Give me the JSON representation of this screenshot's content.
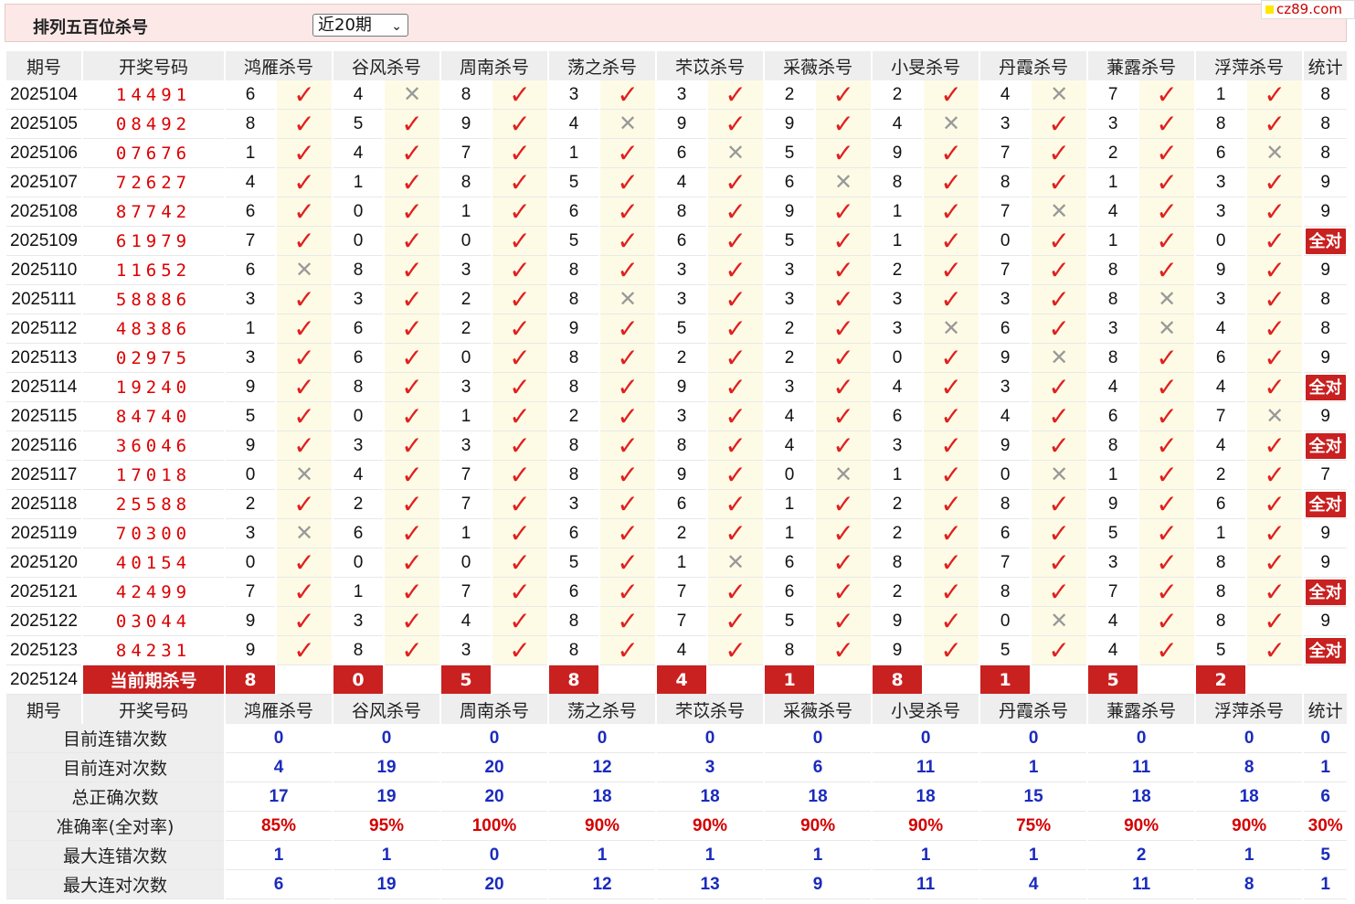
{
  "header": {
    "title": "排列五百位杀号",
    "select_value": "近20期",
    "logo": "cz89.com"
  },
  "columns": {
    "issue": "期号",
    "draw": "开奖号码",
    "experts": [
      "鸿雁杀号",
      "谷风杀号",
      "周南杀号",
      "荡之杀号",
      "芣苡杀号",
      "采薇杀号",
      "小旻杀号",
      "丹霞杀号",
      "蒹露杀号",
      "浮萍杀号"
    ],
    "stat": "统计"
  },
  "rows": [
    {
      "issue": "2025104",
      "draw": "14491",
      "kills": [
        6,
        4,
        8,
        3,
        3,
        2,
        2,
        4,
        7,
        1
      ],
      "hits": [
        1,
        0,
        1,
        1,
        1,
        1,
        1,
        0,
        1,
        1
      ],
      "stat": "8"
    },
    {
      "issue": "2025105",
      "draw": "08492",
      "kills": [
        8,
        5,
        9,
        4,
        9,
        9,
        4,
        3,
        3,
        8
      ],
      "hits": [
        1,
        1,
        1,
        0,
        1,
        1,
        0,
        1,
        1,
        1
      ],
      "stat": "8"
    },
    {
      "issue": "2025106",
      "draw": "07676",
      "kills": [
        1,
        4,
        7,
        1,
        6,
        5,
        9,
        7,
        2,
        6
      ],
      "hits": [
        1,
        1,
        1,
        1,
        0,
        1,
        1,
        1,
        1,
        0
      ],
      "stat": "8"
    },
    {
      "issue": "2025107",
      "draw": "72627",
      "kills": [
        4,
        1,
        8,
        5,
        4,
        6,
        8,
        8,
        1,
        3
      ],
      "hits": [
        1,
        1,
        1,
        1,
        1,
        0,
        1,
        1,
        1,
        1
      ],
      "stat": "9"
    },
    {
      "issue": "2025108",
      "draw": "87742",
      "kills": [
        6,
        0,
        1,
        6,
        8,
        9,
        1,
        7,
        4,
        3
      ],
      "hits": [
        1,
        1,
        1,
        1,
        1,
        1,
        1,
        0,
        1,
        1
      ],
      "stat": "9"
    },
    {
      "issue": "2025109",
      "draw": "61979",
      "kills": [
        7,
        0,
        0,
        5,
        6,
        5,
        1,
        0,
        1,
        0
      ],
      "hits": [
        1,
        1,
        1,
        1,
        1,
        1,
        1,
        1,
        1,
        1
      ],
      "stat": "全对"
    },
    {
      "issue": "2025110",
      "draw": "11652",
      "kills": [
        6,
        8,
        3,
        8,
        3,
        3,
        2,
        7,
        8,
        9
      ],
      "hits": [
        0,
        1,
        1,
        1,
        1,
        1,
        1,
        1,
        1,
        1
      ],
      "stat": "9"
    },
    {
      "issue": "2025111",
      "draw": "58886",
      "kills": [
        3,
        3,
        2,
        8,
        3,
        3,
        3,
        3,
        8,
        3
      ],
      "hits": [
        1,
        1,
        1,
        0,
        1,
        1,
        1,
        1,
        0,
        1
      ],
      "stat": "8"
    },
    {
      "issue": "2025112",
      "draw": "48386",
      "kills": [
        1,
        6,
        2,
        9,
        5,
        2,
        3,
        6,
        3,
        4
      ],
      "hits": [
        1,
        1,
        1,
        1,
        1,
        1,
        0,
        1,
        0,
        1
      ],
      "stat": "8"
    },
    {
      "issue": "2025113",
      "draw": "02975",
      "kills": [
        3,
        6,
        0,
        8,
        2,
        2,
        0,
        9,
        8,
        6
      ],
      "hits": [
        1,
        1,
        1,
        1,
        1,
        1,
        1,
        0,
        1,
        1
      ],
      "stat": "9"
    },
    {
      "issue": "2025114",
      "draw": "19240",
      "kills": [
        9,
        8,
        3,
        8,
        9,
        3,
        4,
        3,
        4,
        4
      ],
      "hits": [
        1,
        1,
        1,
        1,
        1,
        1,
        1,
        1,
        1,
        1
      ],
      "stat": "全对"
    },
    {
      "issue": "2025115",
      "draw": "84740",
      "kills": [
        5,
        0,
        1,
        2,
        3,
        4,
        6,
        4,
        6,
        7
      ],
      "hits": [
        1,
        1,
        1,
        1,
        1,
        1,
        1,
        1,
        1,
        0
      ],
      "stat": "9"
    },
    {
      "issue": "2025116",
      "draw": "36046",
      "kills": [
        9,
        3,
        3,
        8,
        8,
        4,
        3,
        9,
        8,
        4
      ],
      "hits": [
        1,
        1,
        1,
        1,
        1,
        1,
        1,
        1,
        1,
        1
      ],
      "stat": "全对"
    },
    {
      "issue": "2025117",
      "draw": "17018",
      "kills": [
        0,
        4,
        7,
        8,
        9,
        0,
        1,
        0,
        1,
        2
      ],
      "hits": [
        0,
        1,
        1,
        1,
        1,
        0,
        1,
        0,
        1,
        1
      ],
      "stat": "7"
    },
    {
      "issue": "2025118",
      "draw": "25588",
      "kills": [
        2,
        2,
        7,
        3,
        6,
        1,
        2,
        8,
        9,
        6
      ],
      "hits": [
        1,
        1,
        1,
        1,
        1,
        1,
        1,
        1,
        1,
        1
      ],
      "stat": "全对"
    },
    {
      "issue": "2025119",
      "draw": "70300",
      "kills": [
        3,
        6,
        1,
        6,
        2,
        1,
        2,
        6,
        5,
        1
      ],
      "hits": [
        0,
        1,
        1,
        1,
        1,
        1,
        1,
        1,
        1,
        1
      ],
      "stat": "9"
    },
    {
      "issue": "2025120",
      "draw": "40154",
      "kills": [
        0,
        0,
        0,
        5,
        1,
        6,
        8,
        7,
        3,
        8
      ],
      "hits": [
        1,
        1,
        1,
        1,
        0,
        1,
        1,
        1,
        1,
        1
      ],
      "stat": "9"
    },
    {
      "issue": "2025121",
      "draw": "42499",
      "kills": [
        7,
        1,
        7,
        6,
        7,
        6,
        2,
        8,
        7,
        8
      ],
      "hits": [
        1,
        1,
        1,
        1,
        1,
        1,
        1,
        1,
        1,
        1
      ],
      "stat": "全对"
    },
    {
      "issue": "2025122",
      "draw": "03044",
      "kills": [
        9,
        3,
        4,
        8,
        7,
        5,
        9,
        0,
        4,
        8
      ],
      "hits": [
        1,
        1,
        1,
        1,
        1,
        1,
        1,
        0,
        1,
        1
      ],
      "stat": "9"
    },
    {
      "issue": "2025123",
      "draw": "84231",
      "kills": [
        9,
        8,
        3,
        8,
        4,
        8,
        9,
        5,
        4,
        5
      ],
      "hits": [
        1,
        1,
        1,
        1,
        1,
        1,
        1,
        1,
        1,
        1
      ],
      "stat": "全对"
    }
  ],
  "current": {
    "issue": "2025124",
    "label": "当前期杀号",
    "kills": [
      8,
      0,
      5,
      8,
      4,
      1,
      8,
      1,
      5,
      2
    ]
  },
  "stats": [
    {
      "label": "目前连错次数",
      "values": [
        "0",
        "0",
        "0",
        "0",
        "0",
        "0",
        "0",
        "0",
        "0",
        "0",
        "0"
      ],
      "color": "blue"
    },
    {
      "label": "目前连对次数",
      "values": [
        "4",
        "19",
        "20",
        "12",
        "3",
        "6",
        "11",
        "1",
        "11",
        "8",
        "1"
      ],
      "color": "blue"
    },
    {
      "label": "总正确次数",
      "values": [
        "17",
        "19",
        "20",
        "18",
        "18",
        "18",
        "18",
        "15",
        "18",
        "18",
        "6"
      ],
      "color": "blue"
    },
    {
      "label": "准确率(全对率)",
      "values": [
        "85%",
        "95%",
        "100%",
        "90%",
        "90%",
        "90%",
        "90%",
        "75%",
        "90%",
        "90%",
        "30%"
      ],
      "color": "red"
    },
    {
      "label": "最大连错次数",
      "values": [
        "1",
        "1",
        "0",
        "1",
        "1",
        "1",
        "1",
        "1",
        "2",
        "1",
        "5"
      ],
      "color": "blue"
    },
    {
      "label": "最大连对次数",
      "values": [
        "6",
        "19",
        "20",
        "12",
        "13",
        "9",
        "11",
        "4",
        "11",
        "8",
        "1"
      ],
      "color": "blue"
    }
  ],
  "marks": {
    "check": "✓",
    "cross": "✕"
  },
  "colors": {
    "accent": "#c92020",
    "hit": "#e0201f",
    "miss": "#999999",
    "mark_cell_bg": "#fdfbe6",
    "header_bg": "#eeeeee",
    "top_bar_bg": "#fde8e8"
  }
}
